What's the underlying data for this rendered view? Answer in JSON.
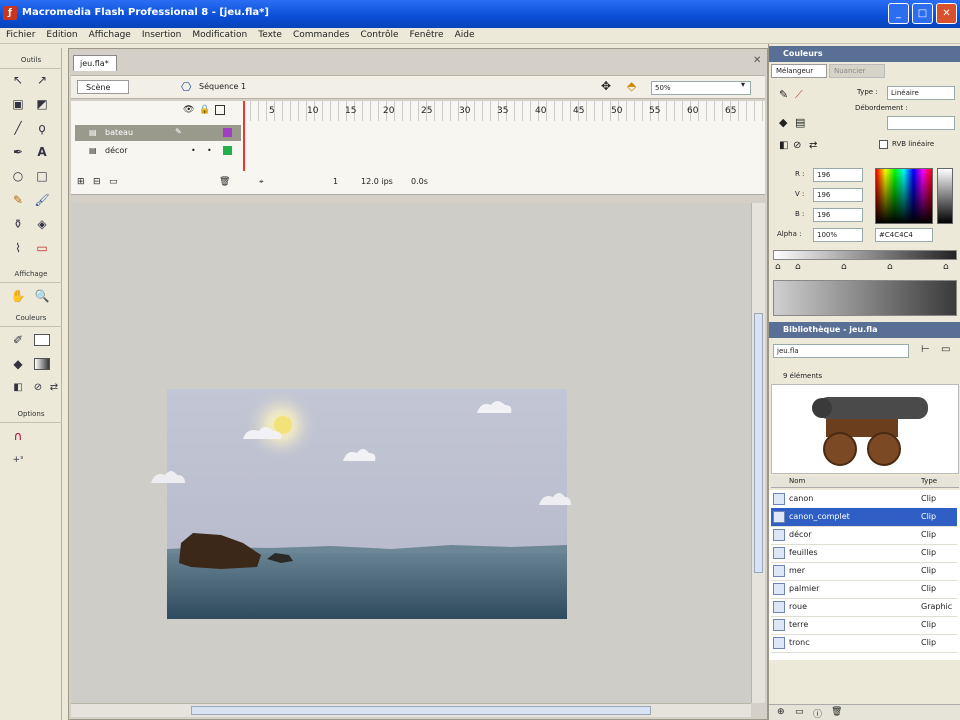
{
  "window": {
    "title": "Macromedia Flash Professional 8 - [jeu.fla*]"
  },
  "menu": [
    "Fichier",
    "Edition",
    "Affichage",
    "Insertion",
    "Modification",
    "Texte",
    "Commandes",
    "Contrôle",
    "Fenêtre",
    "Aide"
  ],
  "tools": {
    "outils_label": "Outils",
    "affichage_label": "Affichage",
    "couleurs_label": "Couleurs",
    "options_label": "Options"
  },
  "document": {
    "tab": "jeu.fla*",
    "scene_button": "Scène",
    "breadcrumb": "Séquence 1",
    "zoom": "50%",
    "layers": [
      {
        "name": "bateau"
      },
      {
        "name": "décor"
      }
    ],
    "frame_numbers": [
      "5",
      "10",
      "15",
      "20",
      "25",
      "30",
      "35",
      "40",
      "45",
      "50",
      "55",
      "60",
      "65"
    ],
    "current_frame": "1",
    "fps": "12.0 ips",
    "elapsed": "0.0s"
  },
  "colors_panel": {
    "title": "Couleurs",
    "tab_mixer": "Mélangeur",
    "tab_swatches": "Nuancier",
    "type_label": "Type :",
    "type_value": "Linéaire",
    "overflow_label": "Débordement :",
    "linear_rgb_label": "RVB linéaire",
    "r_label": "R :",
    "r_value": "196",
    "g_label": "V :",
    "g_value": "196",
    "b_label": "B :",
    "b_value": "196",
    "alpha_label": "Alpha :",
    "alpha_value": "100%",
    "hex_value": "#C4C4C4"
  },
  "library_panel": {
    "title": "Bibliothèque - jeu.fla",
    "file": "jeu.fla",
    "count": "9 éléments",
    "col_name": "Nom",
    "col_type": "Type",
    "items": [
      {
        "name": "canon",
        "type": "Clip"
      },
      {
        "name": "canon_complet",
        "type": "Clip"
      },
      {
        "name": "décor",
        "type": "Clip"
      },
      {
        "name": "feuilles",
        "type": "Clip"
      },
      {
        "name": "mer",
        "type": "Clip"
      },
      {
        "name": "palmier",
        "type": "Clip"
      },
      {
        "name": "roue",
        "type": "Graphic"
      },
      {
        "name": "terre",
        "type": "Clip"
      },
      {
        "name": "tronc",
        "type": "Clip"
      }
    ],
    "selected_index": 1
  },
  "colors": {
    "accent": "#2f5fc4",
    "titlebar": "#0a4fd6",
    "panel_header": "#5a6f96"
  }
}
